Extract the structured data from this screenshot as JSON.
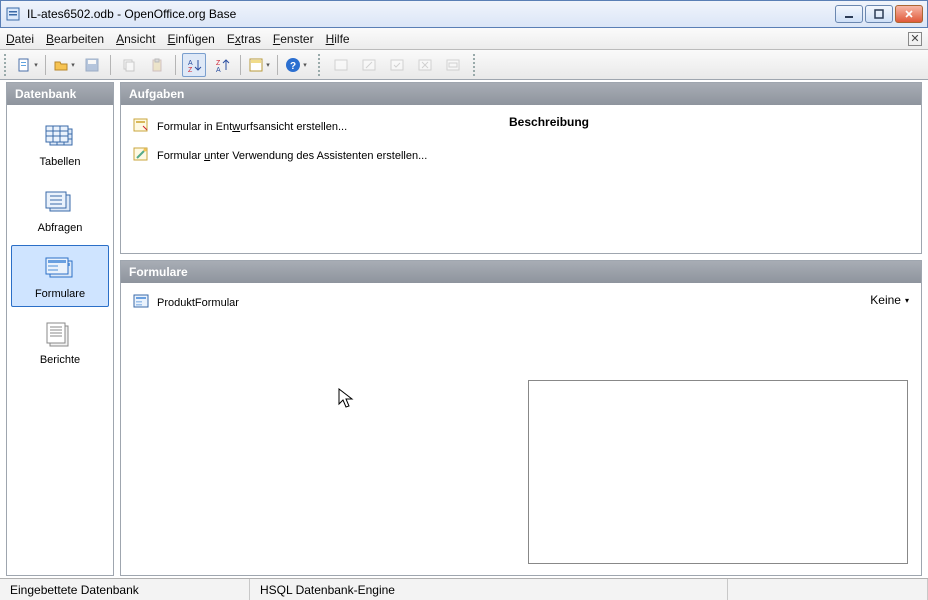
{
  "window": {
    "title": "IL-ates6502.odb - OpenOffice.org Base"
  },
  "menu": {
    "datei": "Datei",
    "bearbeiten": "Bearbeiten",
    "ansicht": "Ansicht",
    "einfuegen": "Einfügen",
    "extras": "Extras",
    "fenster": "Fenster",
    "hilfe": "Hilfe"
  },
  "sidebar": {
    "title": "Datenbank",
    "items": {
      "tables": "Tabellen",
      "queries": "Abfragen",
      "forms": "Formulare",
      "reports": "Berichte"
    }
  },
  "tasks": {
    "title": "Aufgaben",
    "design_view": "Formular in Entwurfsansicht erstellen...",
    "wizard": "Formular unter Verwendung des Assistenten erstellen...",
    "description_label": "Beschreibung"
  },
  "forms": {
    "title": "Formulare",
    "items": [
      "ProduktFormular"
    ],
    "view_mode": "Keine"
  },
  "status": {
    "left": "Eingebettete Datenbank",
    "mid": "HSQL Datenbank-Engine"
  }
}
